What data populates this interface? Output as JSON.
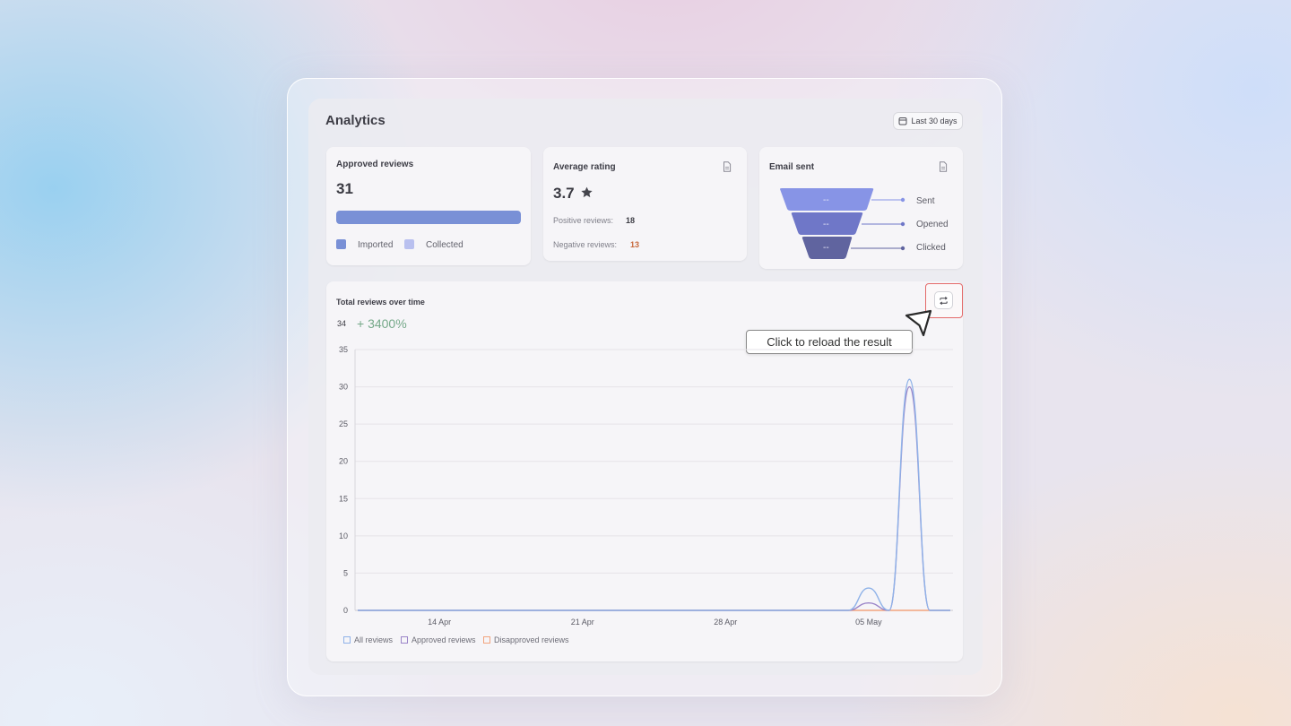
{
  "header": {
    "title": "Analytics",
    "date_range": "Last 30 days"
  },
  "approved_reviews": {
    "title": "Approved reviews",
    "value": "31",
    "legend": [
      {
        "label": "Imported",
        "color": "#7990d6"
      },
      {
        "label": "Collected",
        "color": "#b9c0ef"
      }
    ]
  },
  "average_rating": {
    "title": "Average rating",
    "value": "3.7",
    "positive_label": "Positive reviews:",
    "positive_value": "18",
    "negative_label": "Negative reviews:",
    "negative_value": "13"
  },
  "email_sent": {
    "title": "Email sent",
    "stages": [
      {
        "label": "Sent",
        "value": "--",
        "color": "#8794e6"
      },
      {
        "label": "Opened",
        "value": "--",
        "color": "#6f77c8"
      },
      {
        "label": "Clicked",
        "value": "--",
        "color": "#60649f"
      }
    ]
  },
  "total_reviews": {
    "title": "Total reviews over time",
    "count": "34",
    "change": "+ 3400%"
  },
  "tooltip": {
    "text": "Click to reload the result"
  },
  "chart_data": {
    "type": "line",
    "title": "Total reviews over time",
    "xlabel": "",
    "ylabel": "",
    "x_ticks": [
      "14 Apr",
      "21 Apr",
      "28 Apr",
      "05 May"
    ],
    "x": [
      "10 Apr",
      "11 Apr",
      "12 Apr",
      "13 Apr",
      "14 Apr",
      "15 Apr",
      "16 Apr",
      "17 Apr",
      "18 Apr",
      "19 Apr",
      "20 Apr",
      "21 Apr",
      "22 Apr",
      "23 Apr",
      "24 Apr",
      "25 Apr",
      "26 Apr",
      "27 Apr",
      "28 Apr",
      "29 Apr",
      "30 Apr",
      "01 May",
      "02 May",
      "03 May",
      "04 May",
      "05 May",
      "06 May",
      "07 May",
      "08 May",
      "09 May"
    ],
    "ylim": [
      0,
      35
    ],
    "y_ticks": [
      0,
      5,
      10,
      15,
      20,
      25,
      30,
      35
    ],
    "grid": true,
    "legend": "bottom-left",
    "series": [
      {
        "name": "All reviews",
        "color": "#8fb2e8",
        "values": [
          0,
          0,
          0,
          0,
          0,
          0,
          0,
          0,
          0,
          0,
          0,
          0,
          0,
          0,
          0,
          0,
          0,
          0,
          0,
          0,
          0,
          0,
          0,
          0,
          0,
          3,
          0,
          31,
          0,
          0
        ]
      },
      {
        "name": "Approved reviews",
        "color": "#9a84c8",
        "values": [
          0,
          0,
          0,
          0,
          0,
          0,
          0,
          0,
          0,
          0,
          0,
          0,
          0,
          0,
          0,
          0,
          0,
          0,
          0,
          0,
          0,
          0,
          0,
          0,
          0,
          1,
          0,
          30,
          0,
          0
        ]
      },
      {
        "name": "Disapproved reviews",
        "color": "#f2a47e",
        "values": [
          0,
          0,
          0,
          0,
          0,
          0,
          0,
          0,
          0,
          0,
          0,
          0,
          0,
          0,
          0,
          0,
          0,
          0,
          0,
          0,
          0,
          0,
          0,
          0,
          0,
          0,
          0,
          0,
          0,
          0
        ]
      }
    ]
  }
}
